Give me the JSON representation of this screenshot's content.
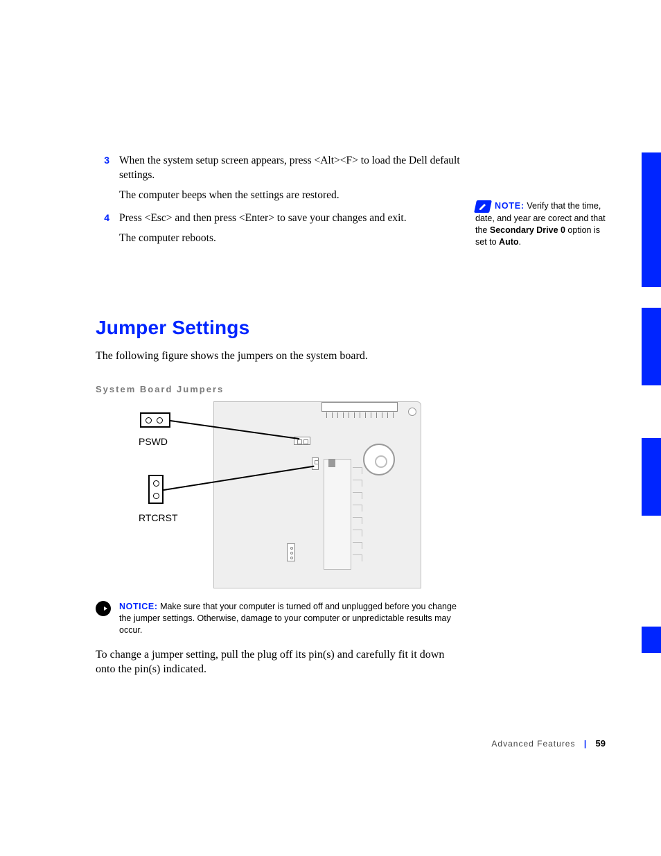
{
  "steps": [
    {
      "num": "3",
      "p1": "When the system setup screen appears, press <Alt><F> to load the Dell default settings.",
      "p2": "The computer beeps when the settings are restored."
    },
    {
      "num": "4",
      "p1": "Press <Esc> and then press <Enter> to save your changes and exit.",
      "p2": "The computer reboots."
    }
  ],
  "note": {
    "label": "NOTE:",
    "pre": " Verify that the time, date, and year are corect and that the ",
    "bold1": "Secondary Drive 0",
    "mid": " option is set to ",
    "bold2": "Auto",
    "post": "."
  },
  "section_heading": "Jumper Settings",
  "lead": "The following figure shows the jumpers on the system board.",
  "figure_caption": "System Board Jumpers",
  "labels": {
    "pswd": "PSWD",
    "rtcrst": "RTCRST"
  },
  "notice": {
    "label": "NOTICE:",
    "body": " Make sure that your computer is turned off and unplugged before you change the jumper settings. Otherwise, damage to your computer or unpredictable results may occur."
  },
  "after_notice": "To change a jumper setting, pull the plug off its pin(s) and carefully fit it down onto the pin(s) indicated.",
  "footer": {
    "section": "Advanced Features",
    "page": "59"
  }
}
